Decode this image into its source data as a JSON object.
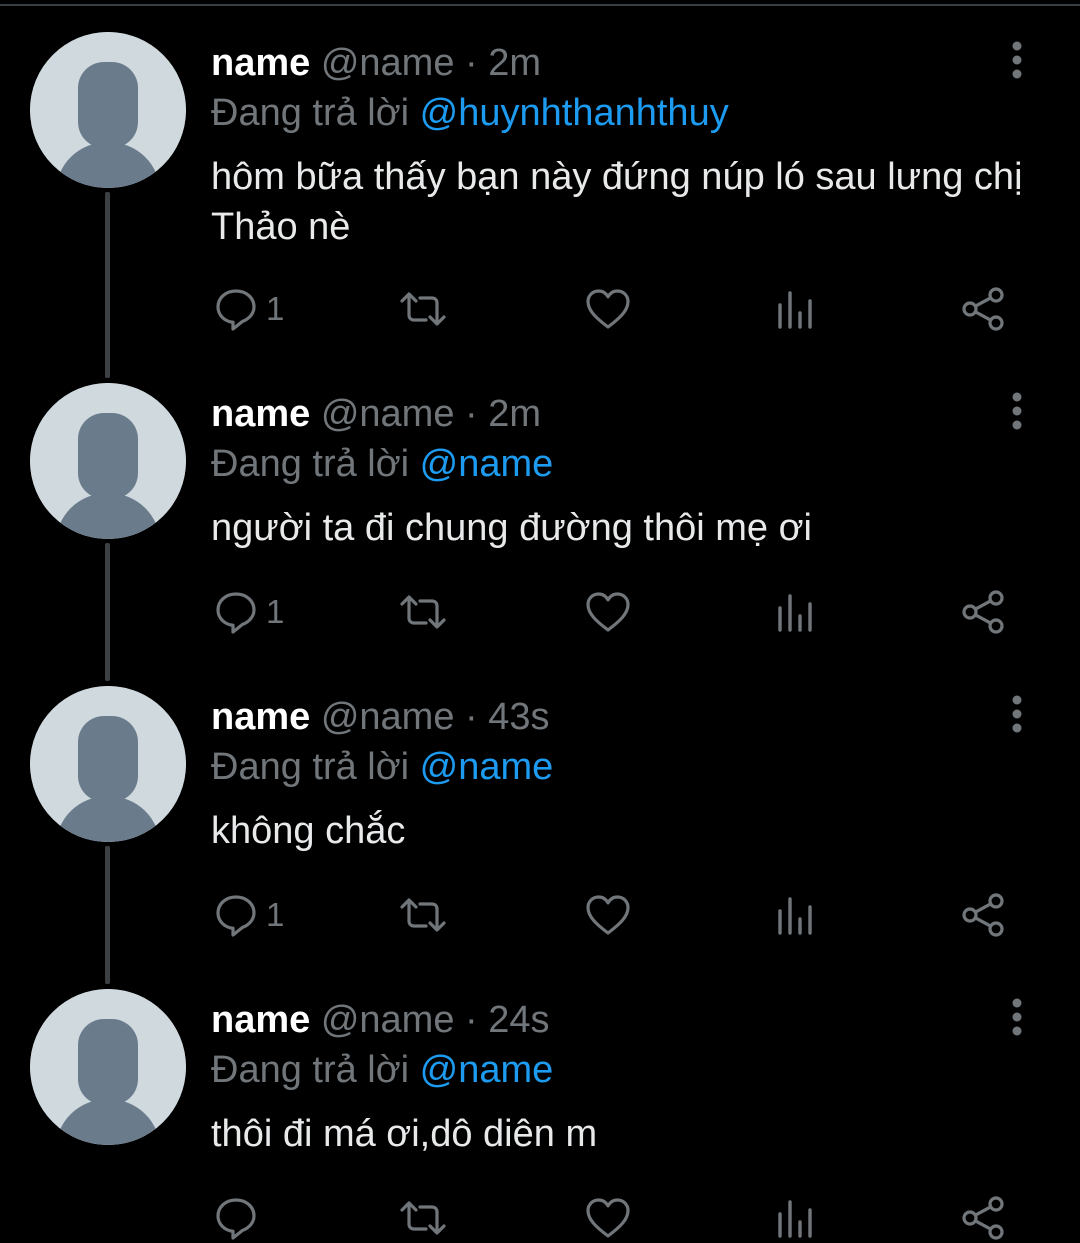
{
  "colors": {
    "background": "#000000",
    "text": "#e7e9ea",
    "secondary": "#71767b",
    "accent": "#1d9bf0",
    "avatar_bg": "#cfd9de",
    "avatar_fg": "#6a7b8c"
  },
  "reply_prefix": "Đang trả lời",
  "tweets": [
    {
      "name": "name",
      "handle": "@name",
      "dot": "·",
      "time": "2m",
      "reply_to": "@huynhthanhthuy",
      "text": "hôm bữa thấy bạn này đứng núp ló sau lưng chị Thảo nè",
      "reply_count": "1",
      "icons": [
        "reply-icon",
        "retweet-icon",
        "like-icon",
        "views-icon",
        "share-icon",
        "more-icon"
      ]
    },
    {
      "name": "name",
      "handle": "@name",
      "dot": "·",
      "time": "2m",
      "reply_to": "@name",
      "text": "người ta đi chung đường thôi mẹ ơi",
      "reply_count": "1"
    },
    {
      "name": "name",
      "handle": "@name",
      "dot": "·",
      "time": "43s",
      "reply_to": "@name",
      "text": "không chắc",
      "reply_count": "1"
    },
    {
      "name": "name",
      "handle": "@name",
      "dot": "·",
      "time": "24s",
      "reply_to": "@name",
      "text": "thôi đi má ơi,dô diên m",
      "reply_count": ""
    }
  ]
}
